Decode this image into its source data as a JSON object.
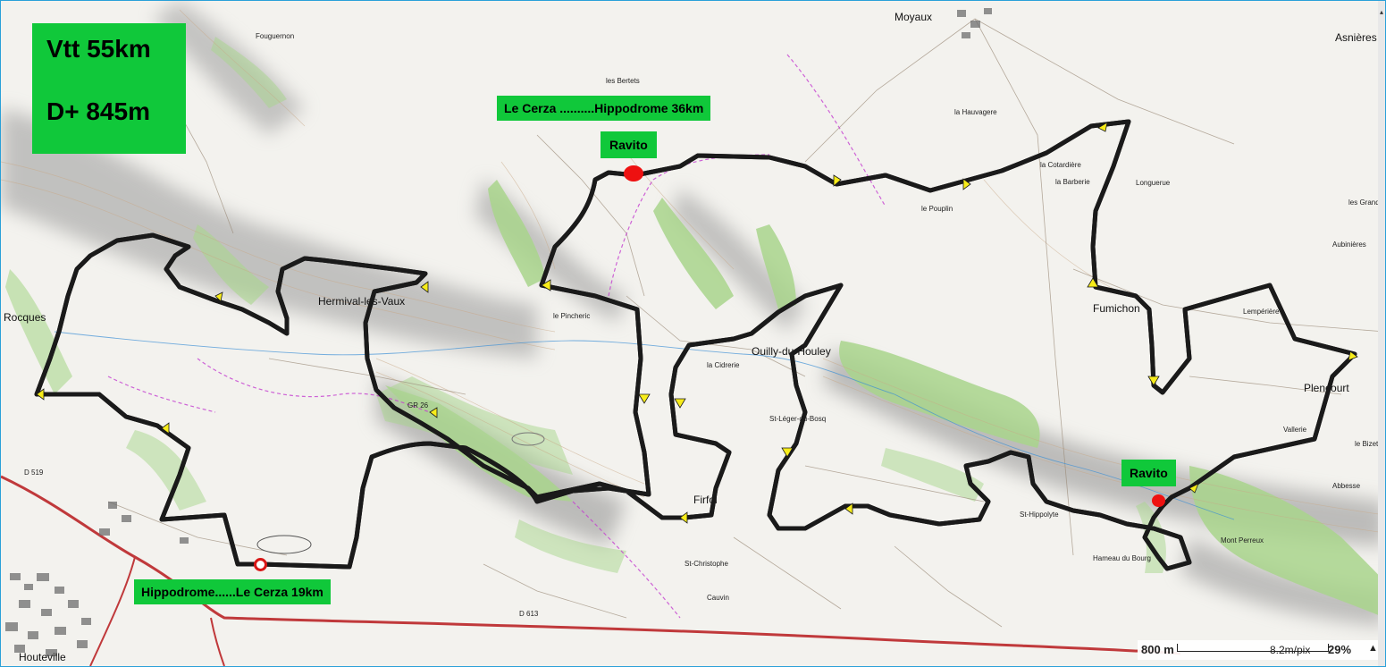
{
  "title": {
    "distance": "Vtt 55km",
    "elevation": "D+ 845m"
  },
  "segments": {
    "cerza_hippodrome": "Le Cerza ..........Hippodrome 36km",
    "hippodrome_cerza": "Hippodrome......Le Cerza 19km"
  },
  "refreshments": {
    "ravito_north": "Ravito",
    "ravito_east": "Ravito"
  },
  "scale": {
    "distance": "800 m",
    "resolution": "8.2m/pix",
    "zoom": "29%",
    "zoom_arrow": "▲"
  },
  "places": [
    {
      "name": "Moyaux",
      "major": true
    },
    {
      "name": "Fumichon",
      "major": true
    },
    {
      "name": "Ouilly-du-Houley",
      "major": true
    },
    {
      "name": "Hermival-les-Vaux",
      "major": true
    },
    {
      "name": "Firfol",
      "major": true
    },
    {
      "name": "Rocques",
      "major": true
    },
    {
      "name": "Asnières",
      "major": true
    },
    {
      "name": "Plencourt",
      "major": true
    },
    {
      "name": "St-Hippolyte",
      "major": false
    },
    {
      "name": "St-Léger-du-Bosq",
      "major": false
    },
    {
      "name": "Lempérière",
      "major": false
    },
    {
      "name": "le Pouplin",
      "major": false
    },
    {
      "name": "la Barberie",
      "major": false
    },
    {
      "name": "Mont Perreux",
      "major": false
    },
    {
      "name": "Hameau du Bourg",
      "major": false
    },
    {
      "name": "Abbesse",
      "major": false
    },
    {
      "name": "le Bizet",
      "major": false
    },
    {
      "name": "Fouguernon",
      "major": false
    },
    {
      "name": "Longuerue",
      "major": false
    },
    {
      "name": "Aubinières",
      "major": false
    },
    {
      "name": "la Cotardière",
      "major": false
    },
    {
      "name": "la Hauvagere",
      "major": false
    },
    {
      "name": "les Bertets",
      "major": false
    },
    {
      "name": "le Pincheric",
      "major": false
    },
    {
      "name": "Houteville",
      "major": false
    },
    {
      "name": "les Grandes",
      "major": false
    },
    {
      "name": "Vallerie",
      "major": false
    },
    {
      "name": "la Cidrerie",
      "major": false
    },
    {
      "name": "St-Christophe",
      "major": false
    },
    {
      "name": "Cauvin",
      "major": false
    }
  ],
  "roads": [
    "D 613",
    "D 519",
    "GR 26"
  ],
  "colors": {
    "route": "#f7ec1a",
    "route_outline": "#1a1a1a",
    "label_bg": "#10c83a",
    "ravito_dot": "#ee1111",
    "forest": "#a9d58c",
    "road_main": "#c0393b",
    "water": "#3a8fd6"
  }
}
